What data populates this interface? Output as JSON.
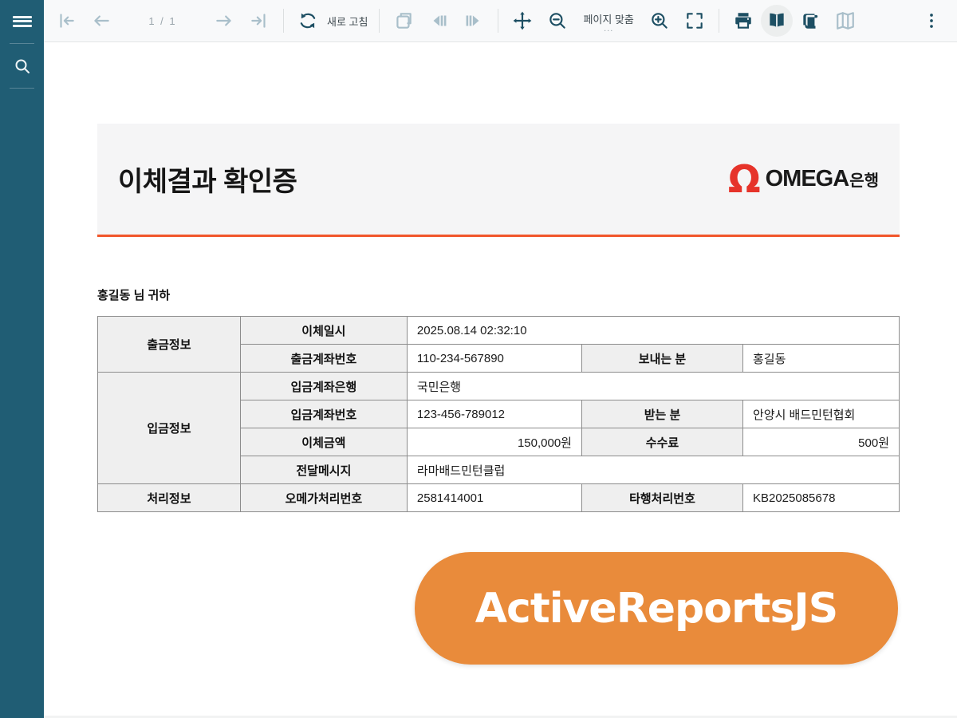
{
  "colors": {
    "sidebar_teal": "#205d74",
    "icon_teal": "#1d4f63",
    "icon_disabled": "#a9bfca",
    "accent_orange_line": "#f1562b",
    "omega_red": "#e6332a",
    "badge_orange": "#e98b3b",
    "label_cell_bg": "#efefef"
  },
  "toolbar": {
    "page_indicator": "1 / 1",
    "refresh_label": "새로 고침",
    "zoom_mode_label": "페이지 맞춤",
    "zoom_mode_ellipsis": "...",
    "icons": [
      "menu",
      "search",
      "first-page",
      "prev-page",
      "next-page",
      "last-page",
      "refresh",
      "cancel-render",
      "history-back",
      "history-forward",
      "move-tool",
      "zoom-out",
      "zoom-in",
      "fullscreen",
      "print",
      "single-page-view",
      "continuous-view",
      "galley-view",
      "more-options"
    ]
  },
  "report": {
    "title": "이체결과 확인증",
    "logo": {
      "symbol": "Ω",
      "name": "OMEGA",
      "suffix": "은행"
    },
    "greeting": "홍길동 님 귀하",
    "table": {
      "col_widths": [
        "17.8%",
        "20.8%",
        "21.8%",
        "20.1%",
        "19.5%"
      ],
      "rows": [
        [
          {
            "t": "출금정보",
            "k": "group",
            "rs": 2
          },
          {
            "t": "이체일시",
            "k": "label"
          },
          {
            "t": "2025.08.14 02:32:10",
            "k": "value",
            "cs": 3
          }
        ],
        [
          {
            "t": "출금계좌번호",
            "k": "label"
          },
          {
            "t": "110-234-567890",
            "k": "value"
          },
          {
            "t": "보내는 분",
            "k": "label"
          },
          {
            "t": "홍길동",
            "k": "value"
          }
        ],
        [
          {
            "t": "입금정보",
            "k": "group",
            "rs": 4
          },
          {
            "t": "입금계좌은행",
            "k": "label"
          },
          {
            "t": "국민은행",
            "k": "value",
            "cs": 3
          }
        ],
        [
          {
            "t": "입금계좌번호",
            "k": "label"
          },
          {
            "t": "123-456-789012",
            "k": "value"
          },
          {
            "t": "받는 분",
            "k": "label"
          },
          {
            "t": "안양시 배드민턴협회",
            "k": "value"
          }
        ],
        [
          {
            "t": "이체금액",
            "k": "label"
          },
          {
            "t": "150,000원",
            "k": "value",
            "al": "right"
          },
          {
            "t": "수수료",
            "k": "label"
          },
          {
            "t": "500원",
            "k": "value",
            "al": "right"
          }
        ],
        [
          {
            "t": "전달메시지",
            "k": "label"
          },
          {
            "t": "라마배드민턴클럽",
            "k": "value",
            "cs": 3
          }
        ],
        [
          {
            "t": "처리정보",
            "k": "group"
          },
          {
            "t": "오메가처리번호",
            "k": "label"
          },
          {
            "t": "2581414001",
            "k": "value"
          },
          {
            "t": "타행처리번호",
            "k": "label"
          },
          {
            "t": "KB2025085678",
            "k": "value"
          }
        ]
      ]
    }
  },
  "badge": {
    "label": "ActiveReportsJS"
  }
}
